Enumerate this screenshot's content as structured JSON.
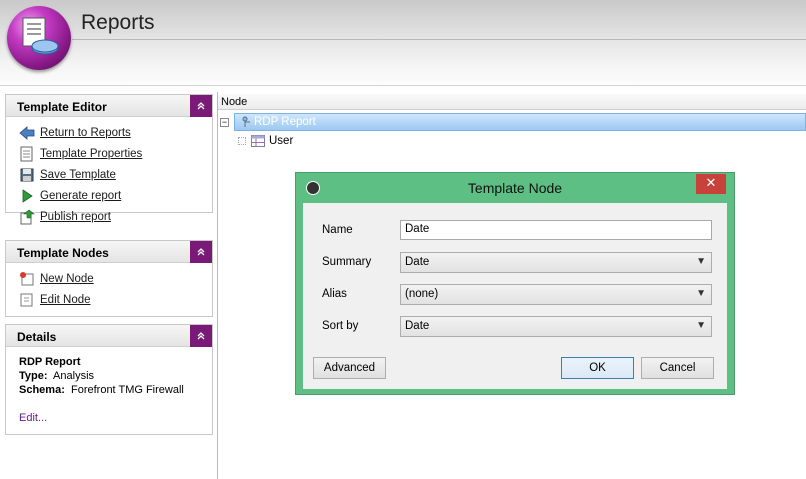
{
  "app": {
    "title": "Reports"
  },
  "sidebar": {
    "template_editor": {
      "title": "Template Editor",
      "items": [
        {
          "label": "Return to Reports",
          "icon": "back-arrow-icon"
        },
        {
          "label": "Template Properties",
          "icon": "properties-icon"
        },
        {
          "label": "Save Template",
          "icon": "save-icon"
        },
        {
          "label": "Generate report",
          "icon": "play-icon"
        },
        {
          "label": "Publish report",
          "icon": "publish-icon"
        }
      ]
    },
    "template_nodes": {
      "title": "Template Nodes",
      "items": [
        {
          "label": "New Node",
          "icon": "new-node-icon"
        },
        {
          "label": "Edit Node",
          "icon": "edit-node-icon"
        }
      ]
    },
    "details": {
      "title": "Details",
      "name": "RDP Report",
      "type_label": "Type:",
      "type_value": "Analysis",
      "schema_label": "Schema:",
      "schema_value": "Forefront TMG Firewall",
      "edit_link": "Edit..."
    }
  },
  "tree": {
    "column_header": "Node",
    "root": {
      "label": "RDP Report",
      "expander": "⊟"
    },
    "children": [
      {
        "label": "User"
      }
    ]
  },
  "dialog": {
    "title": "Template Node",
    "close": "✕",
    "fields": {
      "name": {
        "label": "Name",
        "value": "Date"
      },
      "summary": {
        "label": "Summary",
        "value": "Date"
      },
      "alias": {
        "label": "Alias",
        "value": "(none)"
      },
      "sort_by": {
        "label": "Sort by",
        "value": "Date"
      }
    },
    "buttons": {
      "advanced": "Advanced",
      "ok": "OK",
      "cancel": "Cancel"
    }
  },
  "colors": {
    "accent": "#7a1a78",
    "dialog_frame": "#5ebf85",
    "close": "#c9413b",
    "selection": "#9cc8f2"
  }
}
